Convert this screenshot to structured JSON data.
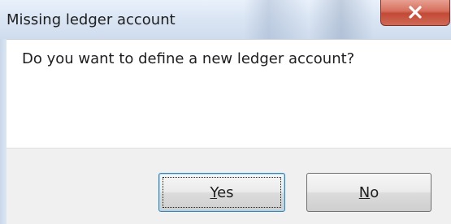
{
  "window": {
    "title": "Missing ledger account",
    "close_icon": "close-icon"
  },
  "message": {
    "text": "Do you want to define a new ledger account?"
  },
  "buttons": {
    "yes": {
      "mnemonic": "Y",
      "rest": "es"
    },
    "no": {
      "mnemonic": "N",
      "rest": "o"
    }
  },
  "colors": {
    "close_button": "#c94f3c",
    "default_button_border": "#3c7fb1"
  }
}
